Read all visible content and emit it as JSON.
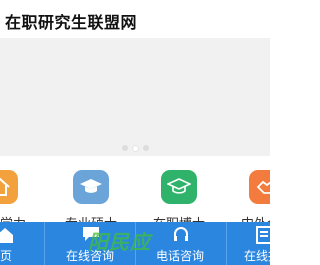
{
  "header": {
    "title": "在职研究生联盟网"
  },
  "banner": {
    "dots": 3,
    "active_dot": 1
  },
  "menu": {
    "items": [
      {
        "label": "同等学力",
        "icon": "house-icon",
        "color": "#f2a13c"
      },
      {
        "label": "专业硕士",
        "icon": "graduation-cap-icon",
        "color": "#6aa4d8"
      },
      {
        "label": "在职博士",
        "icon": "graduation-cap-icon",
        "color": "#2fb36b"
      },
      {
        "label": "中外合作",
        "icon": "handshake-icon",
        "color": "#f37b3d"
      }
    ]
  },
  "tabbar": {
    "background": "#2b86e0",
    "items": [
      {
        "label": "首页",
        "icon": "home-icon"
      },
      {
        "label": "在线咨询",
        "icon": "chat-icon"
      },
      {
        "label": "电话咨询",
        "icon": "headset-icon"
      },
      {
        "label": "在线报名",
        "icon": "form-icon"
      }
    ]
  },
  "watermark": {
    "text": "阳民应"
  }
}
